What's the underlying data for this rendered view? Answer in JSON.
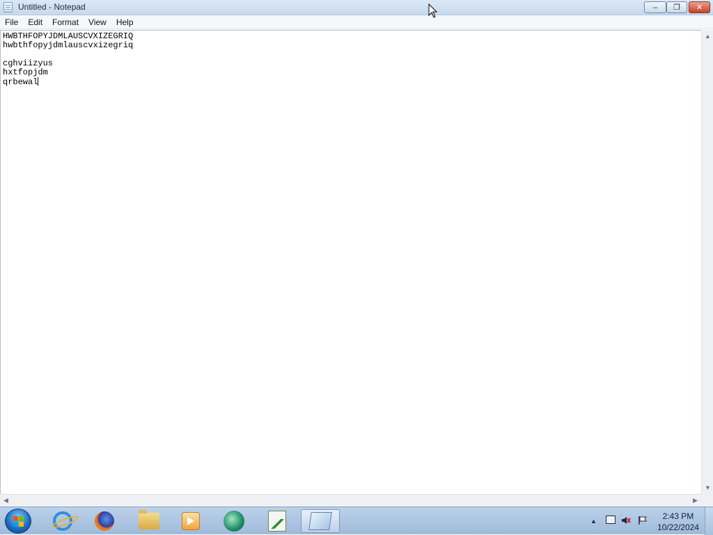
{
  "window": {
    "title": "Untitled - Notepad",
    "buttons": {
      "minimize": "–",
      "maximize": "❐",
      "close": "✕"
    }
  },
  "menu": {
    "items": [
      "File",
      "Edit",
      "Format",
      "View",
      "Help"
    ]
  },
  "editor": {
    "lines": [
      "HWBTHFOPYJDMLAUSCVXIZEGRIQ",
      "hwbthfopyjdmlauscvxizegriq",
      "",
      "cghviizyus",
      "hxtfopjdm",
      "qrbewal"
    ]
  },
  "scrollbars": {
    "up": "▲",
    "down": "▼",
    "left": "◀",
    "right": "▶"
  },
  "taskbar": {
    "apps": [
      {
        "icon": "internet-explorer-icon"
      },
      {
        "icon": "firefox-icon"
      },
      {
        "icon": "file-explorer-icon"
      },
      {
        "icon": "media-player-icon"
      },
      {
        "icon": "teamviewer-icon"
      },
      {
        "icon": "chart-editor-icon"
      },
      {
        "icon": "notepad-icon",
        "active": true
      }
    ],
    "tray": {
      "arrow": "▲"
    },
    "clock": {
      "time": "2:43 PM",
      "date": "10/22/2024"
    }
  }
}
